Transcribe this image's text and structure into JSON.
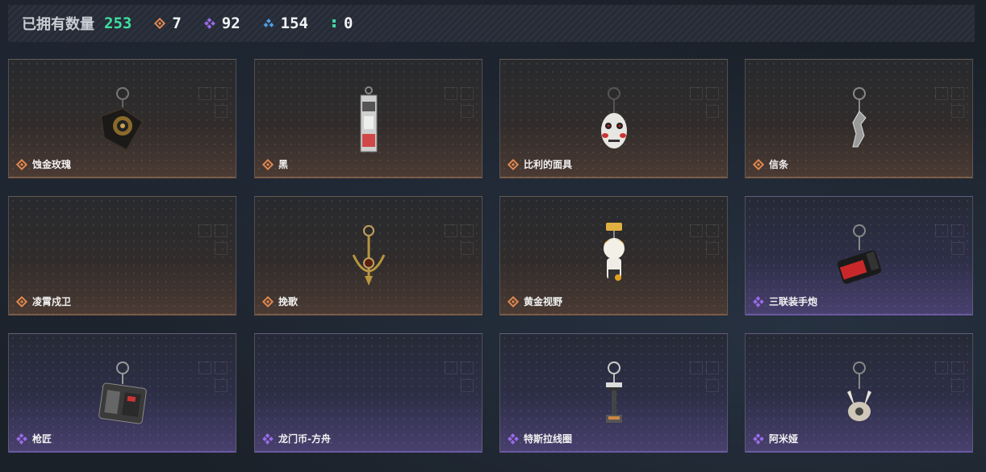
{
  "header": {
    "owned_label": "已拥有数量",
    "owned_count": "253",
    "stats": [
      {
        "icon": "orange-diamond-icon",
        "value": "7",
        "color": "#e0874f"
      },
      {
        "icon": "purple-diamond-icon",
        "value": "92",
        "color": "#9b6be8"
      },
      {
        "icon": "blue-triangle-icon",
        "value": "154",
        "color": "#4f9ee8"
      },
      {
        "icon": "green-dots-icon",
        "value": "0",
        "color": "#3fd6a4"
      }
    ]
  },
  "items": [
    {
      "name": "蚀金玫瑰",
      "rarity": "orange"
    },
    {
      "name": "黑",
      "rarity": "orange"
    },
    {
      "name": "比利的面具",
      "rarity": "orange"
    },
    {
      "name": "信条",
      "rarity": "orange"
    },
    {
      "name": "凌霄戍卫",
      "rarity": "orange"
    },
    {
      "name": "挽歌",
      "rarity": "orange"
    },
    {
      "name": "黄金视野",
      "rarity": "orange"
    },
    {
      "name": "三联装手炮",
      "rarity": "purple"
    },
    {
      "name": "枪匠",
      "rarity": "purple"
    },
    {
      "name": "龙门币-方舟",
      "rarity": "purple"
    },
    {
      "name": "特斯拉线圈",
      "rarity": "purple"
    },
    {
      "name": "阿米娅",
      "rarity": "purple"
    }
  ],
  "colors": {
    "orange": "#e0874f",
    "purple": "#9b6be8",
    "count_green": "#3fe0a0"
  }
}
